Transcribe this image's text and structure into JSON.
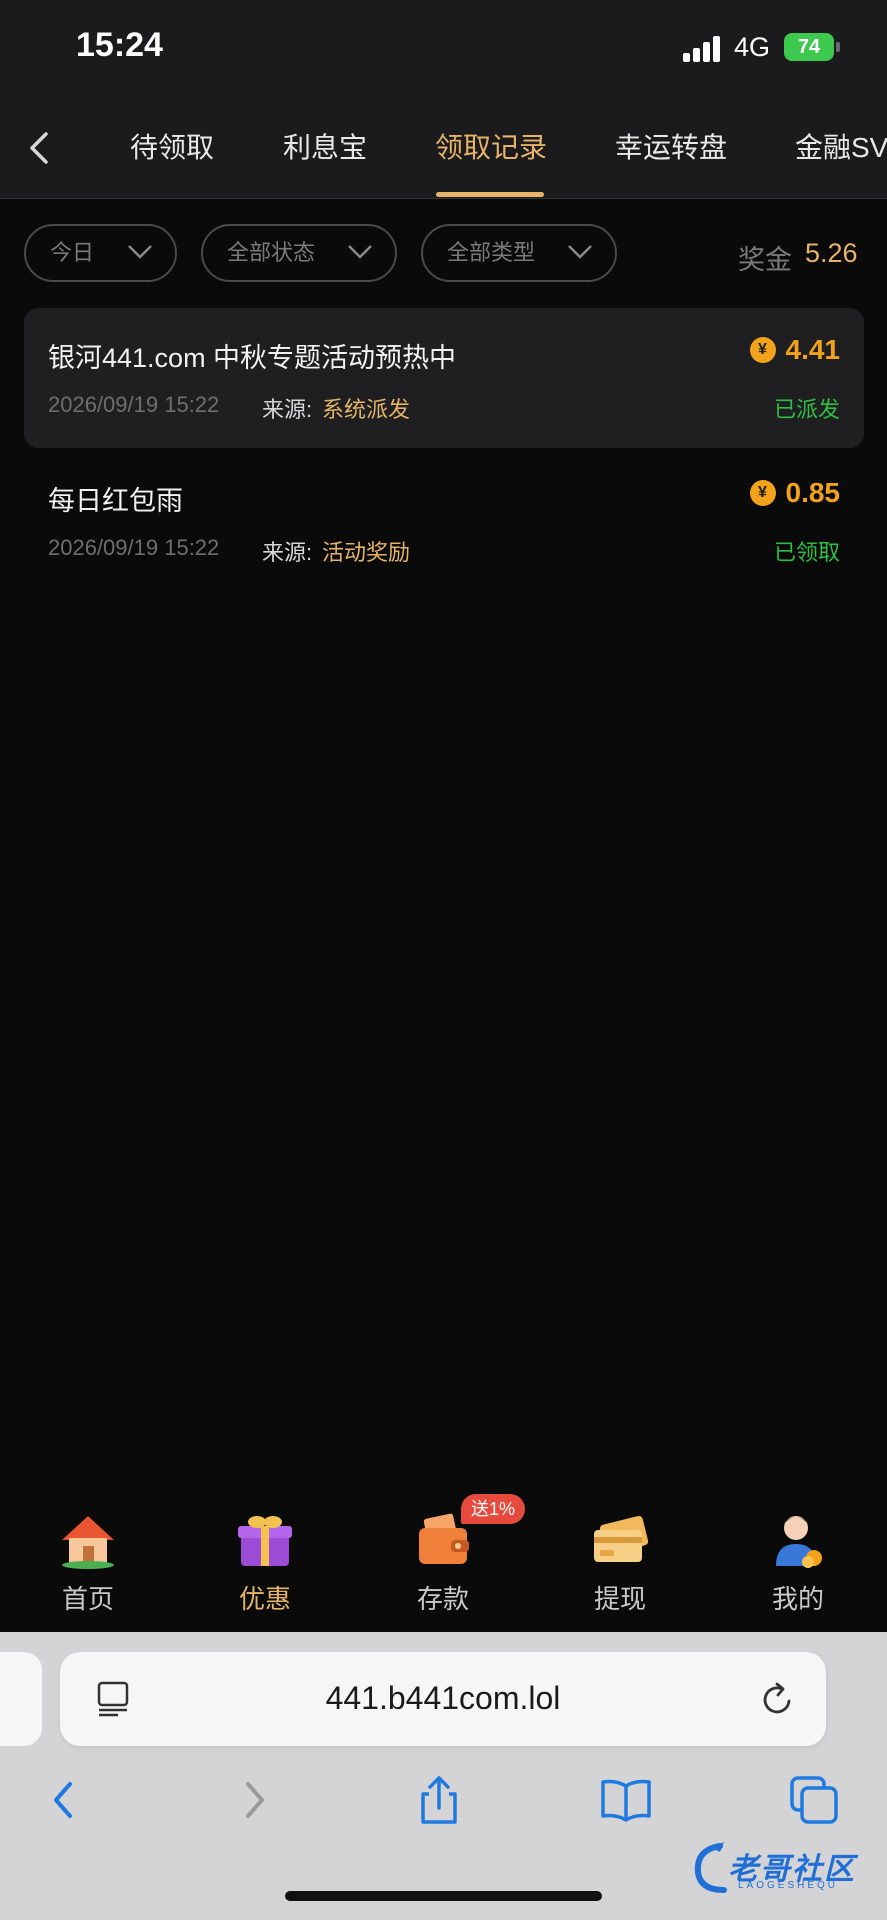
{
  "status_bar": {
    "time": "15:24",
    "network": "4G",
    "battery": "74"
  },
  "tabs": [
    {
      "label": "待领取"
    },
    {
      "label": "利息宝"
    },
    {
      "label": "领取记录"
    },
    {
      "label": "幸运转盘"
    },
    {
      "label": "金融SV"
    }
  ],
  "filters": {
    "date": "今日",
    "status": "全部状态",
    "type": "全部类型",
    "bonus_label": "奖金",
    "bonus_value": "5.26"
  },
  "records": [
    {
      "title": "银河441.com 中秋专题活动预热中",
      "amount": "4.41",
      "date": "2026/09/19 15:22",
      "source_label": "来源:",
      "source": "系统派发",
      "status": "已派发"
    },
    {
      "title": "每日红包雨",
      "amount": "0.85",
      "date": "2026/09/19 15:22",
      "source_label": "来源:",
      "source": "活动奖励",
      "status": "已领取"
    }
  ],
  "coin_symbol": "¥",
  "bottom_nav": {
    "items": [
      {
        "label": "首页",
        "icon": "house-icon"
      },
      {
        "label": "优惠",
        "icon": "gift-icon"
      },
      {
        "label": "存款",
        "icon": "wallet-icon"
      },
      {
        "label": "提现",
        "icon": "card-icon"
      },
      {
        "label": "我的",
        "icon": "user-icon"
      }
    ],
    "badge": "送1%"
  },
  "browser": {
    "url": "441.b441com.lol"
  },
  "watermark": {
    "text": "老哥社区",
    "sub": "LAOGESHEQU"
  },
  "colors": {
    "accent": "#e5b36a",
    "coin": "#f2a31b",
    "success": "#2fbf45",
    "badge": "#e64a3c",
    "background": "#0a0a0a"
  }
}
